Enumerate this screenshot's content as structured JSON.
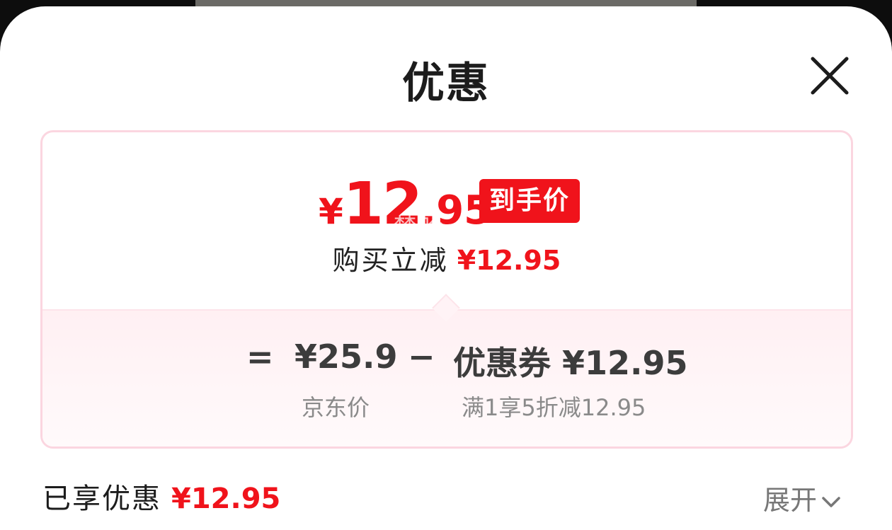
{
  "sheet": {
    "title": "优惠",
    "close_icon": "close-icon"
  },
  "price_card": {
    "final_price": {
      "currency": "¥",
      "integer": "12",
      "decimal": ".95"
    },
    "badge": "到手价",
    "watermark": "梦哈",
    "instant_reduction": {
      "label": "购买立减",
      "amount": "¥12.95"
    },
    "formula": {
      "equals": "=",
      "base_price": "¥25.9",
      "minus": "−",
      "coupon": "优惠券 ¥12.95",
      "base_price_label": "京东价",
      "coupon_rule": "满1享5折减12.95"
    }
  },
  "footer": {
    "enjoyed_label": "已享优惠",
    "enjoyed_amount": "¥12.95",
    "expand_label": "展开",
    "expand_icon": "chevron-down-icon"
  },
  "colors": {
    "accent_red": "#f0131b",
    "card_border": "#fbd6e0"
  }
}
